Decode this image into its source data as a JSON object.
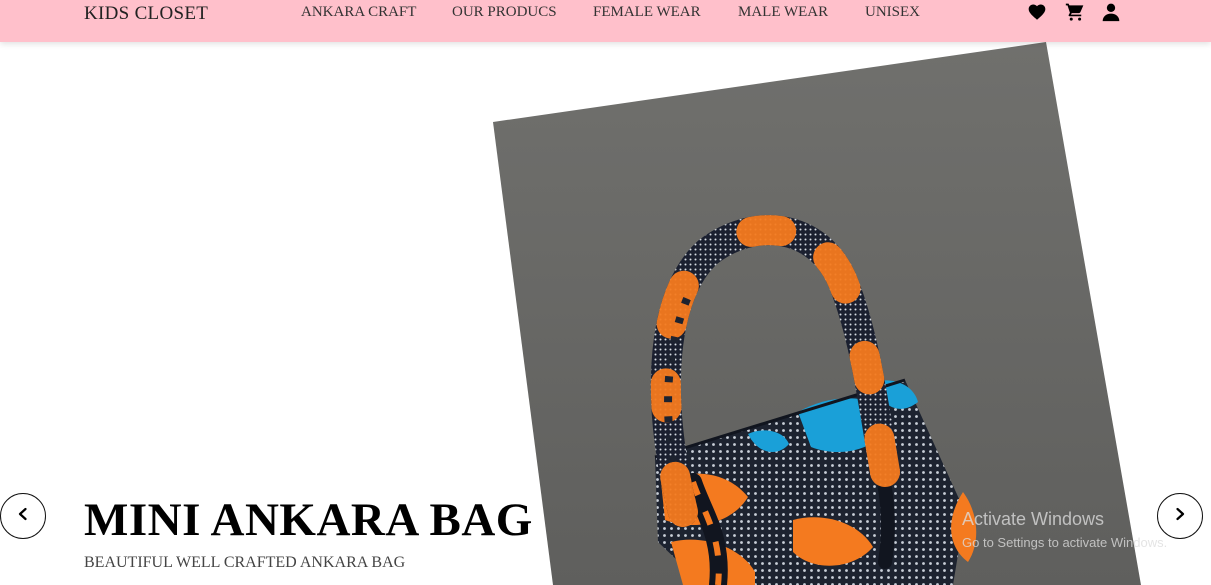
{
  "navbar": {
    "brand": "KIDS CLOSET",
    "links": [
      {
        "label": "ANKARA CRAFT"
      },
      {
        "label": "OUR PRODUCS"
      },
      {
        "label": "FEMALE WEAR"
      },
      {
        "label": "MALE WEAR"
      },
      {
        "label": "UNISEX"
      }
    ],
    "icons": [
      "heart-icon",
      "cart-icon",
      "user-icon"
    ]
  },
  "hero": {
    "title": "MINI ANKARA BAG",
    "subtitle": "BEAUTIFUL WELL CRAFTED ANKARA BAG",
    "image_subject": "ankara print handbag",
    "prev_icon": "chevron-left-icon",
    "next_icon": "chevron-right-icon"
  },
  "watermark": {
    "title": "Activate Windows",
    "subtitle": "Go to Settings to activate Windows."
  },
  "colors": {
    "navbar_bg": "#ffc0cb",
    "photo_bg": "#6b6b69",
    "bag_orange": "#f47a1f",
    "bag_blue": "#1aa0d8",
    "bag_dark": "#1d2330"
  }
}
